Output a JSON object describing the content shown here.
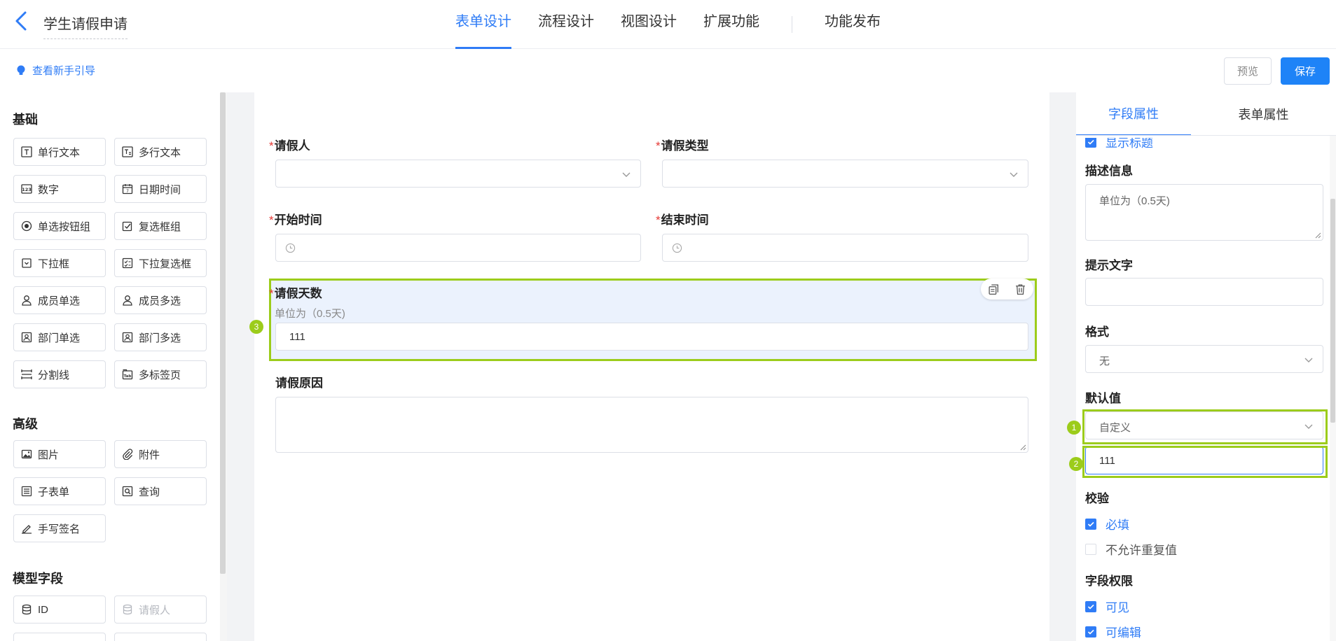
{
  "header": {
    "app_title": "学生请假申请",
    "tabs": [
      {
        "label": "表单设计",
        "active": true
      },
      {
        "label": "流程设计",
        "active": false
      },
      {
        "label": "视图设计",
        "active": false
      },
      {
        "label": "扩展功能",
        "active": false
      }
    ],
    "publish_label": "功能发布"
  },
  "toolbar": {
    "guide_label": "查看新手引导",
    "preview_label": "预览",
    "save_label": "保存"
  },
  "components": {
    "basic_title": "基础",
    "basic": [
      "单行文本",
      "多行文本",
      "数字",
      "日期时间",
      "单选按钮组",
      "复选框组",
      "下拉框",
      "下拉复选框",
      "成员单选",
      "成员多选",
      "部门单选",
      "部门多选",
      "分割线",
      "多标签页"
    ],
    "advanced_title": "高级",
    "advanced": [
      "图片",
      "附件",
      "子表单",
      "查询",
      "手写签名"
    ],
    "model_title": "模型字段",
    "model": [
      "ID",
      "请假人"
    ]
  },
  "form": {
    "field_applicant": "请假人",
    "field_type": "请假类型",
    "field_start": "开始时间",
    "field_end": "结束时间",
    "field_days": "请假天数",
    "field_days_desc": "单位为（0.5天)",
    "field_days_value": "111",
    "field_reason": "请假原因",
    "required_mark": "*"
  },
  "markers": {
    "m1": "1",
    "m2": "2",
    "m3": "3"
  },
  "props": {
    "tab_field": "字段属性",
    "tab_form": "表单属性",
    "show_title": "显示标题",
    "desc_label": "描述信息",
    "desc_value": "单位为（0.5天)",
    "hint_label": "提示文字",
    "format_label": "格式",
    "format_value": "无",
    "default_label": "默认值",
    "default_mode": "自定义",
    "default_value": "111",
    "validate_label": "校验",
    "required": "必填",
    "no_dup": "不允许重复值",
    "perm_label": "字段权限",
    "visible": "可见",
    "editable": "可编辑"
  },
  "colors": {
    "accent": "#2f7cf6",
    "save": "#1e83f7",
    "highlight": "#9ccc1b",
    "required": "#e53935"
  }
}
